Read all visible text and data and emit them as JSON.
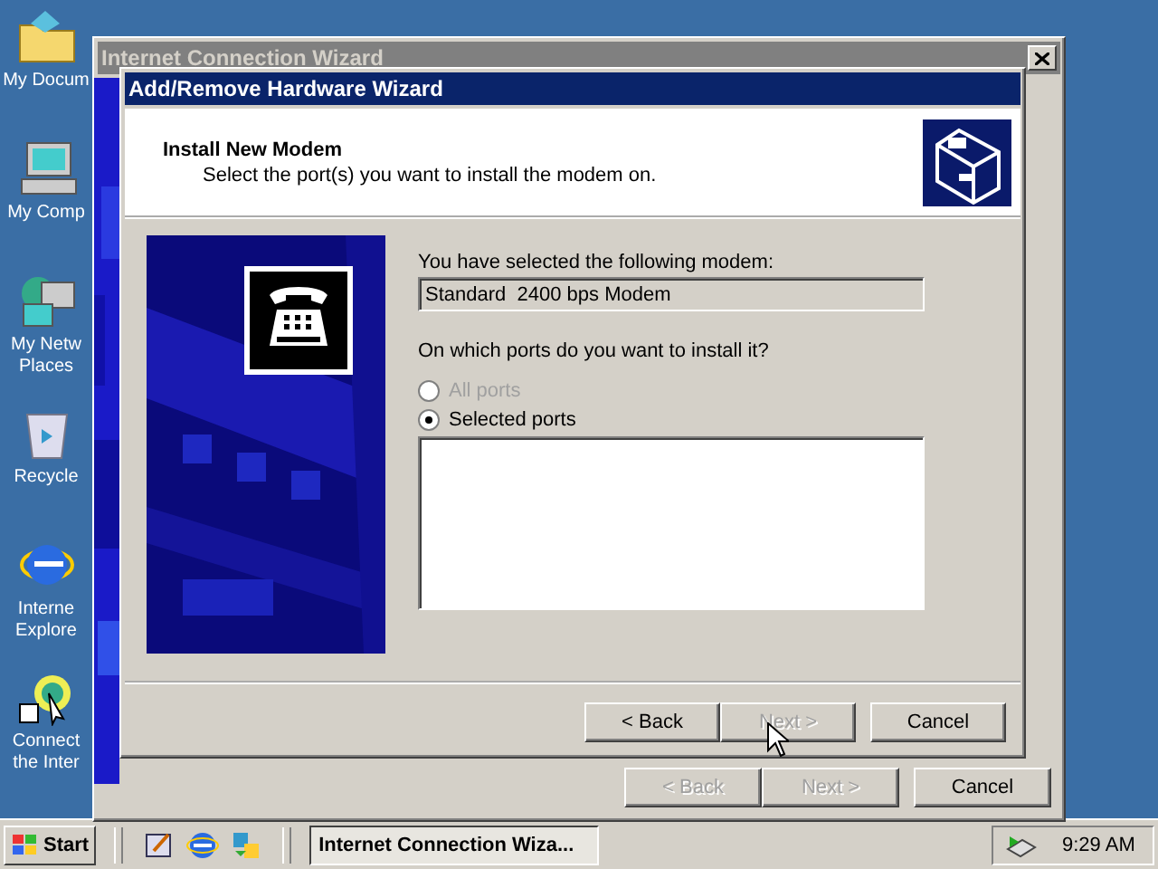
{
  "desktop_icons": [
    {
      "kind": "folder",
      "lines": [
        "My Docum"
      ]
    },
    {
      "kind": "computer",
      "lines": [
        "My Comp"
      ]
    },
    {
      "kind": "network",
      "lines": [
        "My Netw",
        "Places"
      ]
    },
    {
      "kind": "recycle",
      "lines": [
        "Recycle"
      ]
    },
    {
      "kind": "browser",
      "lines": [
        "Interne",
        "Explore"
      ]
    },
    {
      "kind": "connect",
      "lines": [
        "Connect",
        "the Inter"
      ]
    }
  ],
  "back_window": {
    "title": "Internet Connection Wizard",
    "active": false,
    "buttons": [
      {
        "label": "< Back",
        "disabled": true
      },
      {
        "label": "Next >",
        "disabled": true
      },
      {
        "label": "Cancel",
        "disabled": false
      }
    ]
  },
  "dialog": {
    "title": "Add/Remove Hardware Wizard",
    "active": true,
    "heading": "Install New Modem",
    "subheading": "Select the port(s) you want to install the modem on.",
    "modem_label": "You have selected the following modem:",
    "modem_value": "Standard  2400 bps Modem",
    "ports_question": "On which ports do you want to install it?",
    "port_options": [
      {
        "label": "All ports",
        "selected": false,
        "disabled": true
      },
      {
        "label": "Selected ports",
        "selected": true,
        "disabled": false
      }
    ],
    "buttons": [
      {
        "label": "< Back",
        "disabled": false
      },
      {
        "label": "Next >",
        "disabled": true
      },
      {
        "label": "Cancel",
        "disabled": false
      }
    ]
  },
  "taskbar": {
    "start": "Start",
    "tasks": [
      {
        "label": "Internet Connection Wiza...",
        "selected": true
      }
    ],
    "clock": "9:29 AM"
  }
}
